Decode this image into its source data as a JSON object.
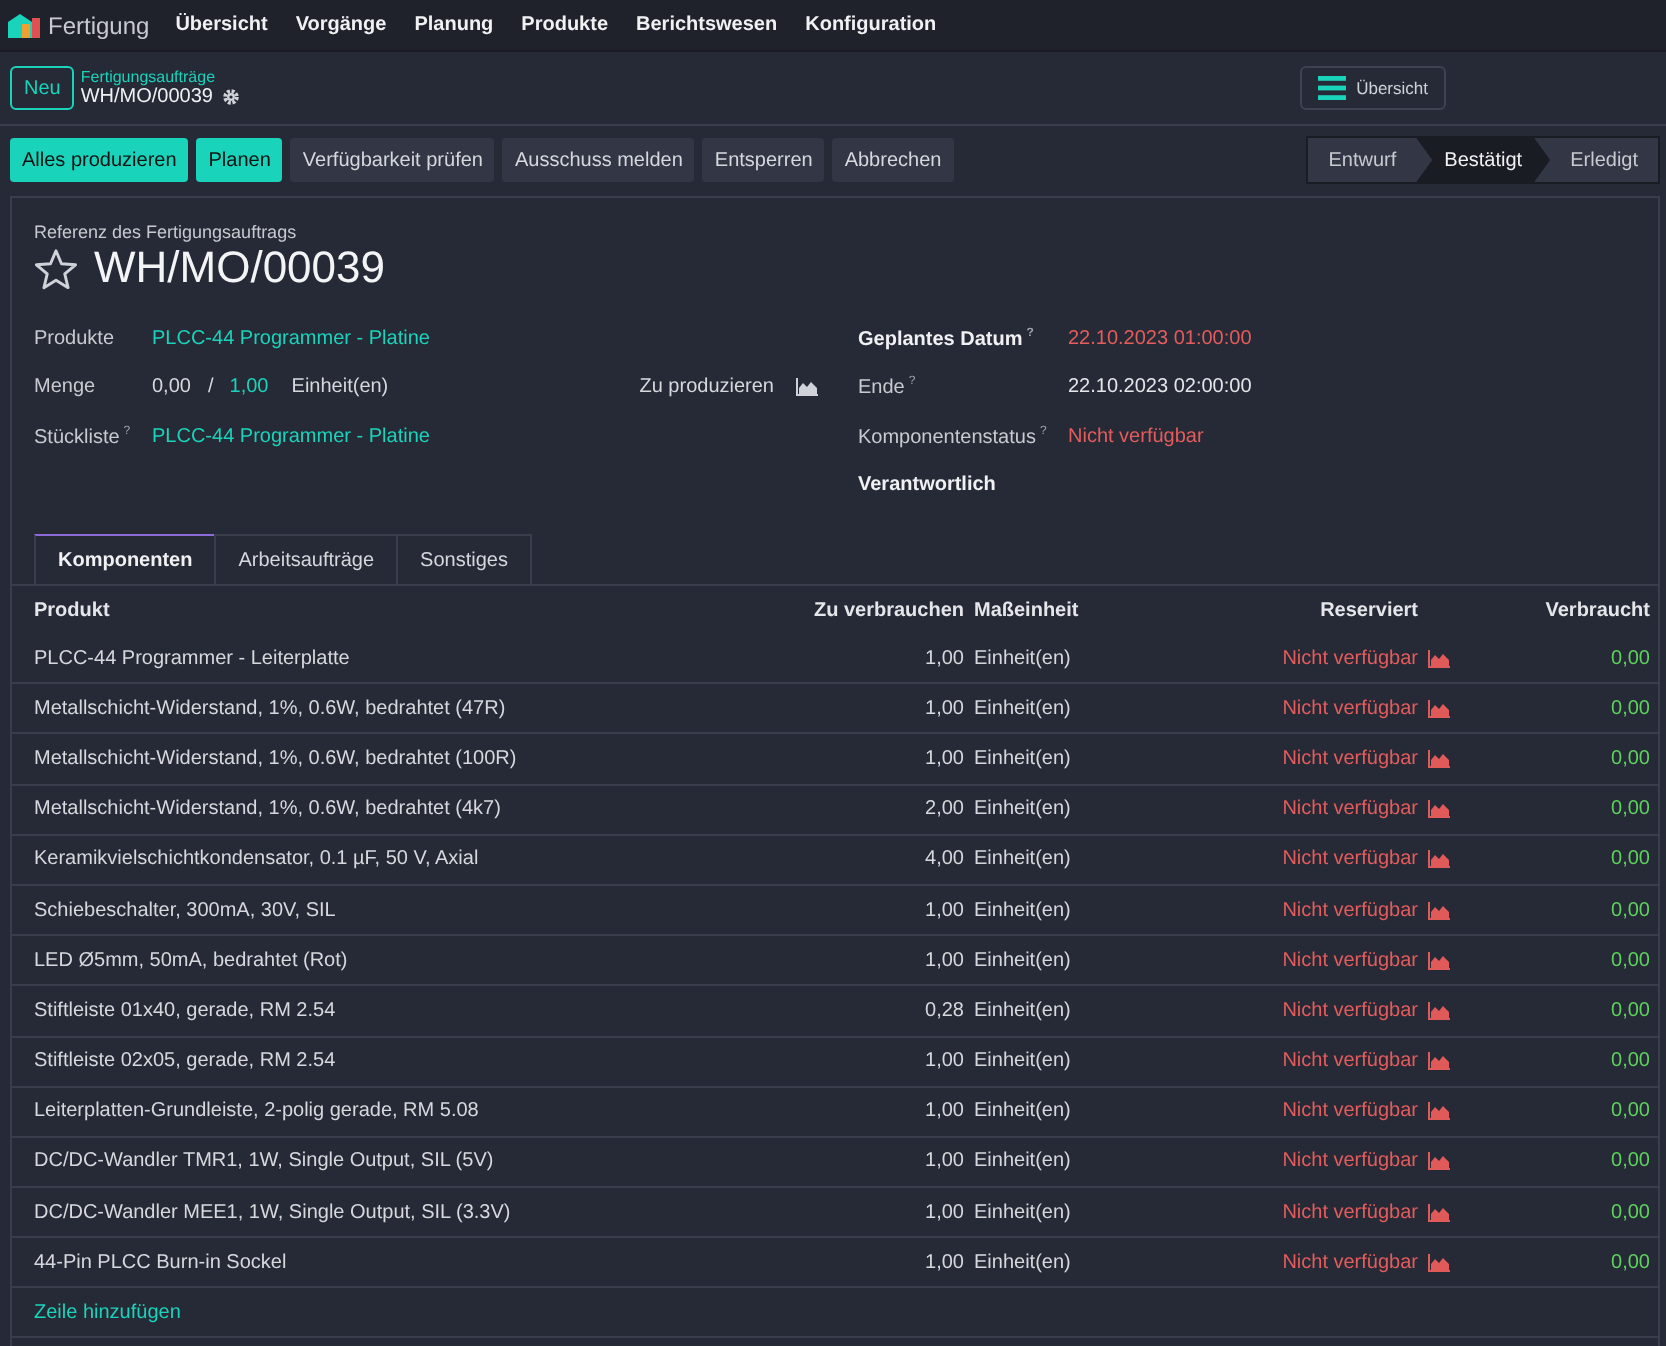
{
  "app": {
    "name": "Fertigung",
    "menus": [
      "Übersicht",
      "Vorgänge",
      "Planung",
      "Produkte",
      "Berichtswesen",
      "Konfiguration"
    ]
  },
  "control_panel": {
    "new_button": "Neu",
    "breadcrumb_parent": "Fertigungsaufträge",
    "breadcrumb_current": "WH/MO/00039",
    "view_button": "Übersicht"
  },
  "actions": [
    {
      "label": "Alles produzieren",
      "highlighted": true
    },
    {
      "label": "Planen",
      "highlighted": true
    },
    {
      "label": "Verfügbarkeit prüfen",
      "highlighted": false
    },
    {
      "label": "Ausschuss melden",
      "highlighted": false
    },
    {
      "label": "Entsperren",
      "highlighted": false
    },
    {
      "label": "Abbrechen",
      "highlighted": false
    }
  ],
  "status_steps": [
    {
      "label": "Entwurf",
      "selected": false
    },
    {
      "label": "Bestätigt",
      "selected": true
    },
    {
      "label": "Erledigt",
      "selected": false
    }
  ],
  "form": {
    "reference_label": "Referenz des Fertigungsauftrags",
    "starred": false,
    "title": "WH/MO/00039",
    "left_fields": [
      {
        "kind": "link",
        "label": "Produkte",
        "value": "PLCC-44 Programmer - Platine"
      },
      {
        "kind": "quantity",
        "label": "Menge",
        "produced": "0,00",
        "separator": "/",
        "planned": "1,00",
        "unit": "Einheit(en)"
      },
      {
        "kind": "link",
        "label": "Stückliste",
        "help": "?",
        "value": "PLCC-44 Programmer - Platine"
      }
    ],
    "forecast_label": "Zu produzieren",
    "right_fields": [
      {
        "label": "Geplantes Datum",
        "help": "?",
        "strong": true,
        "value": "22.10.2023 01:00:00",
        "alert": true
      },
      {
        "label": "Ende",
        "help": "?",
        "strong": false,
        "value": "22.10.2023 02:00:00",
        "alert": false
      },
      {
        "label": "Komponentenstatus",
        "help": "?",
        "strong": false,
        "value": "Nicht verfügbar",
        "alert": true
      },
      {
        "label": "Verantwortlich",
        "strong": true
      }
    ]
  },
  "tabs": [
    {
      "label": "Komponenten",
      "selected": true
    },
    {
      "label": "Arbeitsaufträge",
      "selected": false
    },
    {
      "label": "Sonstiges",
      "selected": false
    }
  ],
  "table": {
    "columns": [
      "Produkt",
      "Zu verbrauchen",
      "Maßeinheit",
      "Reserviert",
      "Verbraucht"
    ],
    "rows": [
      {
        "product": "PLCC-44 Programmer - Leiterplatte",
        "to_consume": "1,00",
        "unit": "Einheit(en)",
        "reserved": "Nicht verfügbar",
        "consumed": "0,00"
      },
      {
        "product": "Metallschicht-Widerstand, 1%, 0.6W, bedrahtet (47R)",
        "to_consume": "1,00",
        "unit": "Einheit(en)",
        "reserved": "Nicht verfügbar",
        "consumed": "0,00"
      },
      {
        "product": "Metallschicht-Widerstand, 1%, 0.6W, bedrahtet (100R)",
        "to_consume": "1,00",
        "unit": "Einheit(en)",
        "reserved": "Nicht verfügbar",
        "consumed": "0,00"
      },
      {
        "product": "Metallschicht-Widerstand, 1%, 0.6W, bedrahtet (4k7)",
        "to_consume": "2,00",
        "unit": "Einheit(en)",
        "reserved": "Nicht verfügbar",
        "consumed": "0,00"
      },
      {
        "product": "Keramikvielschichtkondensator, 0.1 µF, 50 V, Axial",
        "to_consume": "4,00",
        "unit": "Einheit(en)",
        "reserved": "Nicht verfügbar",
        "consumed": "0,00"
      },
      {
        "product": "Schiebeschalter, 300mA, 30V, SIL",
        "to_consume": "1,00",
        "unit": "Einheit(en)",
        "reserved": "Nicht verfügbar",
        "consumed": "0,00"
      },
      {
        "product": "LED Ø5mm, 50mA, bedrahtet (Rot)",
        "to_consume": "1,00",
        "unit": "Einheit(en)",
        "reserved": "Nicht verfügbar",
        "consumed": "0,00"
      },
      {
        "product": "Stiftleiste 01x40, gerade, RM 2.54",
        "to_consume": "0,28",
        "unit": "Einheit(en)",
        "reserved": "Nicht verfügbar",
        "consumed": "0,00"
      },
      {
        "product": "Stiftleiste 02x05, gerade, RM 2.54",
        "to_consume": "1,00",
        "unit": "Einheit(en)",
        "reserved": "Nicht verfügbar",
        "consumed": "0,00"
      },
      {
        "product": "Leiterplatten-Grundleiste, 2-polig gerade, RM 5.08",
        "to_consume": "1,00",
        "unit": "Einheit(en)",
        "reserved": "Nicht verfügbar",
        "consumed": "0,00"
      },
      {
        "product": "DC/DC-Wandler TMR1, 1W, Single Output, SIL (5V)",
        "to_consume": "1,00",
        "unit": "Einheit(en)",
        "reserved": "Nicht verfügbar",
        "consumed": "0,00"
      },
      {
        "product": "DC/DC-Wandler MEE1, 1W, Single Output, SIL (3.3V)",
        "to_consume": "1,00",
        "unit": "Einheit(en)",
        "reserved": "Nicht verfügbar",
        "consumed": "0,00"
      },
      {
        "product": "44-Pin PLCC Burn-in Sockel",
        "to_consume": "1,00",
        "unit": "Einheit(en)",
        "reserved": "Nicht verfügbar",
        "consumed": "0,00"
      }
    ],
    "add_line": "Zeile hinzufügen"
  }
}
